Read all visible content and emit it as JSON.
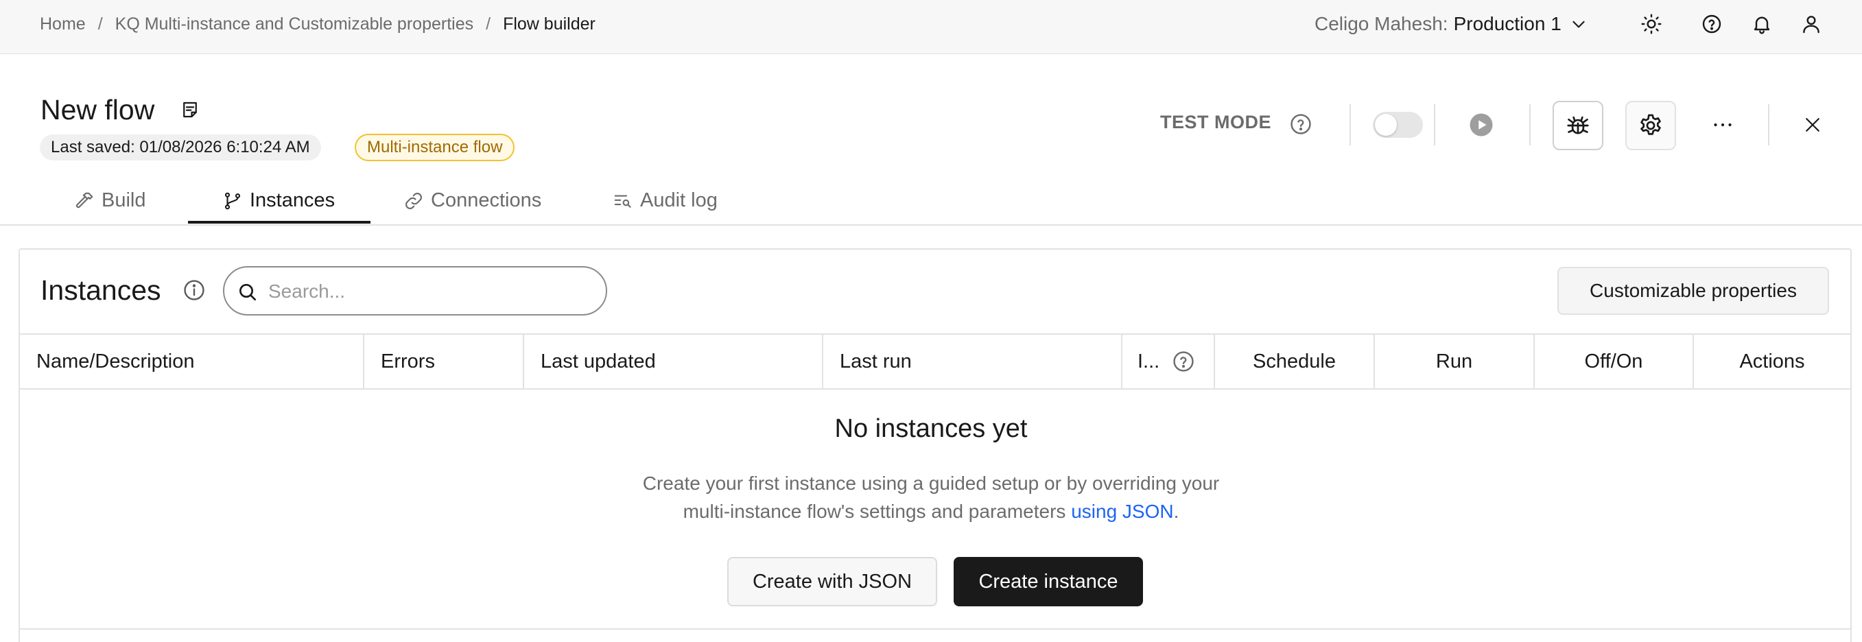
{
  "breadcrumb": {
    "items": [
      "Home",
      "KQ Multi-instance and Customizable properties"
    ],
    "separator": "/",
    "current": "Flow builder"
  },
  "account": {
    "org_label": "Celigo Mahesh:",
    "environment": "Production 1"
  },
  "top_icons": [
    "sun-icon",
    "help-icon",
    "bell-icon",
    "user-icon"
  ],
  "flow": {
    "title": "New flow",
    "last_saved": "Last saved: 01/08/2026 6:10:24 AM",
    "badge": "Multi-instance flow"
  },
  "toolbar": {
    "test_mode_label": "TEST MODE",
    "test_mode_on": false
  },
  "tabs": [
    {
      "label": "Build",
      "icon": "hammer-icon",
      "active": false
    },
    {
      "label": "Instances",
      "icon": "branch-icon",
      "active": true
    },
    {
      "label": "Connections",
      "icon": "link-icon",
      "active": false
    },
    {
      "label": "Audit log",
      "icon": "audit-list-icon",
      "active": false
    }
  ],
  "instances": {
    "title": "Instances",
    "search_placeholder": "Search...",
    "customizable_button": "Customizable properties",
    "columns": [
      "Name/Description",
      "Errors",
      "Last updated",
      "Last run",
      "I...",
      "Schedule",
      "Run",
      "Off/On",
      "Actions"
    ],
    "empty": {
      "title": "No instances yet",
      "line1": "Create your first instance using a guided setup or by overriding your",
      "line2_prefix": "multi-instance flow's settings and parameters",
      "link_text": "using JSON",
      "line2_suffix": "."
    },
    "create_json_button": "Create with JSON",
    "create_instance_button": "Create instance"
  },
  "colors": {
    "badge_border": "#f2c230",
    "badge_text": "#a06a00",
    "link": "#1c64f2",
    "primary_button": "#1a1a1a"
  }
}
